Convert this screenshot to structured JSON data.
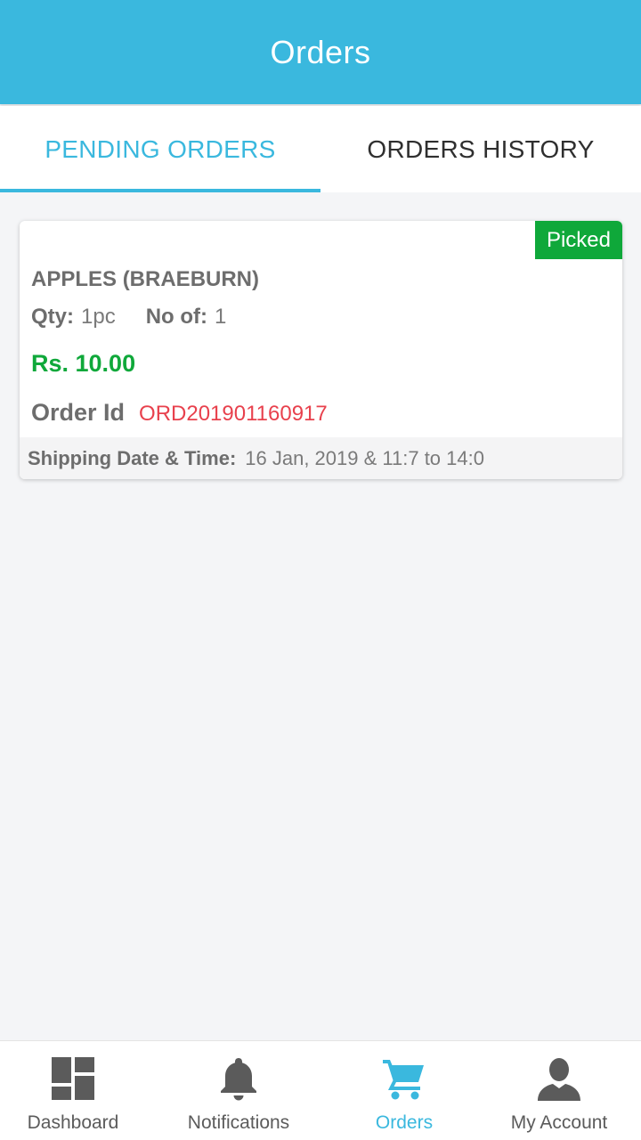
{
  "header": {
    "title": "Orders"
  },
  "tabs": [
    {
      "label": "PENDING ORDERS",
      "active": true
    },
    {
      "label": "ORDERS HISTORY",
      "active": false
    }
  ],
  "order": {
    "status": "Picked",
    "product_name": "APPLES (BRAEBURN)",
    "qty_label": "Qty:",
    "qty_value": "1pc",
    "no_of_label": "No of:",
    "no_of_value": "1",
    "price": "Rs. 10.00",
    "order_id_label": "Order Id",
    "order_id": "ORD201901160917",
    "shipping_label": "Shipping Date & Time:",
    "shipping_value": "16 Jan, 2019 & 11:7 to 14:0"
  },
  "bottom_nav": [
    {
      "label": "Dashboard",
      "icon": "dashboard-icon",
      "active": false
    },
    {
      "label": "Notifications",
      "icon": "bell-icon",
      "active": false
    },
    {
      "label": "Orders",
      "icon": "cart-icon",
      "active": true
    },
    {
      "label": "My Account",
      "icon": "person-icon",
      "active": false
    }
  ],
  "colors": {
    "primary": "#3ab8de",
    "success": "#0fa83a",
    "order_id": "#e8414d",
    "text_dark": "#2f2f2f",
    "text_muted": "#6d6d6d",
    "background": "#f4f5f7"
  }
}
